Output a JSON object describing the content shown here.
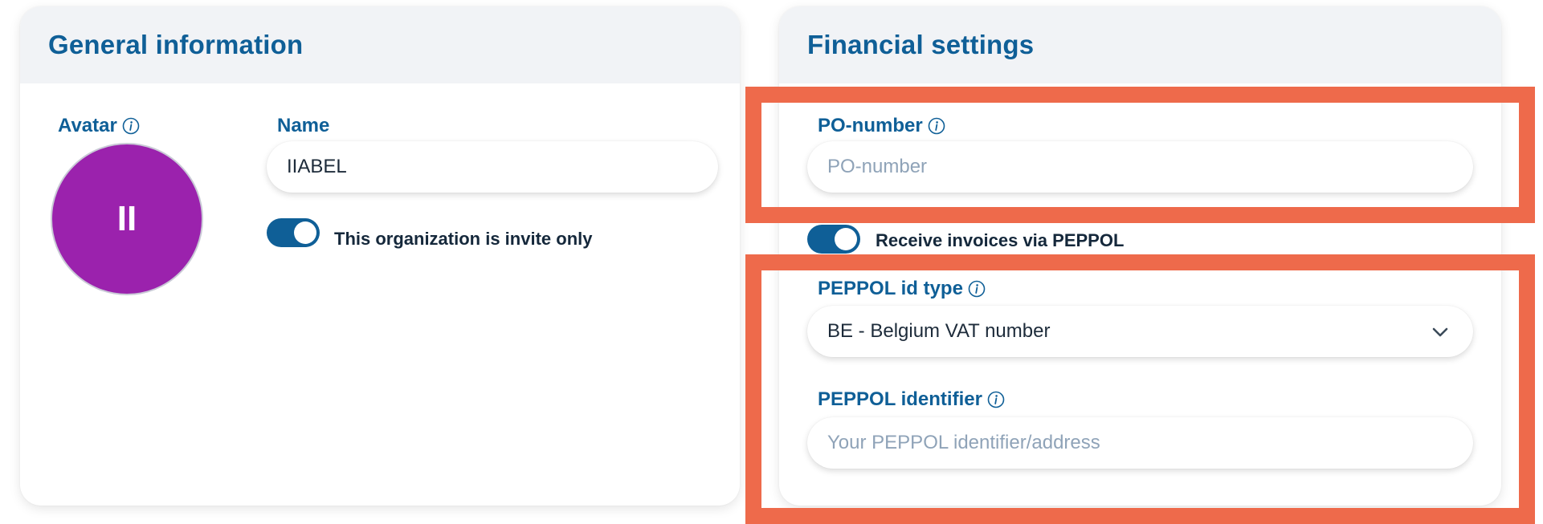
{
  "general": {
    "title": "General information",
    "avatar_label": "Avatar",
    "avatar_initials": "II",
    "avatar_color": "#9b22ad",
    "name_label": "Name",
    "name_value": "IIABEL",
    "invite_only_label": "This organization is invite only",
    "invite_only_on": true
  },
  "financial": {
    "title": "Financial settings",
    "po_label": "PO-number",
    "po_placeholder": "PO-number",
    "peppol_toggle_label": "Receive invoices via PEPPOL",
    "peppol_toggle_on": true,
    "peppol_type_label": "PEPPOL id type",
    "peppol_type_value": "BE - Belgium VAT number",
    "peppol_identifier_label": "PEPPOL identifier",
    "peppol_identifier_placeholder": "Your PEPPOL identifier/address"
  },
  "colors": {
    "accent": "#0f5f97",
    "highlight": "#ee6a4b",
    "header_bg": "#f1f3f6"
  },
  "icons": {
    "info": "info-circle-icon",
    "chevron": "chevron-down-icon"
  }
}
